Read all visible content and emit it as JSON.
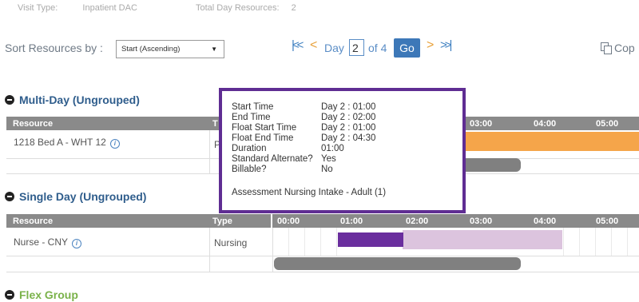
{
  "top_info": {
    "visit_type_label": "Visit Type:",
    "visit_type_value": "Inpatient DAC",
    "total_day_label": "Total Day Resources:",
    "total_day_value": "2"
  },
  "sort": {
    "label": "Sort Resources by :",
    "selected": "Start (Ascending)"
  },
  "pager": {
    "first_icon": "double-chevron-left",
    "prev_icon": "chevron-left",
    "day_label": "Day",
    "day_value": "2",
    "of_label": "of 4",
    "go_label": "Go",
    "next_icon": "chevron-right",
    "last_icon": "double-chevron-right"
  },
  "copy": {
    "label": "Cop",
    "icon": "copy-icon"
  },
  "colors": {
    "accent": "#3d78b8",
    "arrow_orange": "#e8a13a",
    "header_gray": "#8a8a8a",
    "heading_blue": "#2f5d8c",
    "flex_green": "#7ab24a",
    "tooltip_border": "#5f2d93",
    "bar_purple": "#6a2e9e",
    "bar_lilac": "#dcc4de",
    "bar_orange": "#f5a54a",
    "bar_gray": "#808080"
  },
  "groups": {
    "multi_day": {
      "title": "Multi-Day (Ungrouped)",
      "col_resource": "Resource",
      "col_type": "T",
      "times": [
        "03:00",
        "04:00",
        "05:00"
      ],
      "row": {
        "resource": "1218 Bed A - WHT 12",
        "type": "P"
      }
    },
    "single_day": {
      "title": "Single Day (Ungrouped)",
      "col_resource": "Resource",
      "col_type": "Type",
      "times": [
        "00:00",
        "01:00",
        "02:00",
        "03:00",
        "04:00",
        "05:00"
      ],
      "row": {
        "resource": "Nurse - CNY",
        "type": "Nursing"
      }
    },
    "flex": {
      "title": "Flex Group"
    }
  },
  "tooltip": {
    "rows": [
      {
        "label": "Start Time",
        "value": "Day 2 : 01:00"
      },
      {
        "label": "End Time",
        "value": "Day 2 : 02:00"
      },
      {
        "label": "Float Start Time",
        "value": "Day 2 : 01:00"
      },
      {
        "label": "Float End Time",
        "value": "Day 2 : 04:30"
      },
      {
        "label": "Duration",
        "value": "01:00"
      },
      {
        "label": "Standard Alternate?",
        "value": "Yes"
      },
      {
        "label": "Billable?",
        "value": "No"
      }
    ],
    "activity": "Assessment Nursing Intake - Adult (1)"
  }
}
